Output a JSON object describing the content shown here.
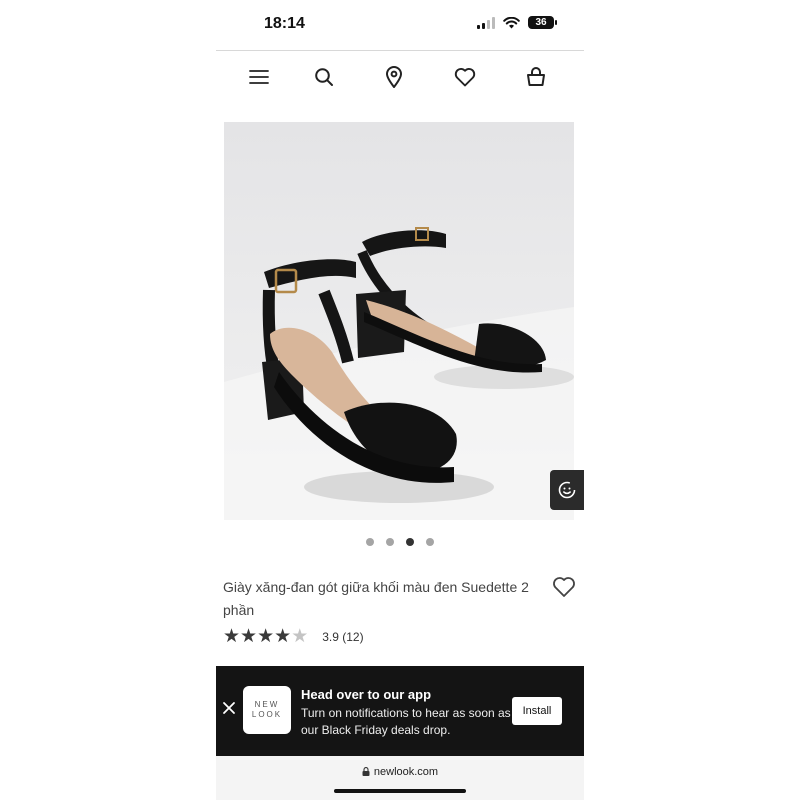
{
  "status_bar": {
    "time": "18:14",
    "battery": "36"
  },
  "nav": {
    "icons": [
      "menu-icon",
      "search-icon",
      "location-pin-icon",
      "heart-icon",
      "bag-icon"
    ]
  },
  "carousel": {
    "count": 4,
    "active": 3
  },
  "product": {
    "title": "Giày xăng-đan gót giữa khối màu đen Suedette 2 phần",
    "rating": 3.9,
    "rating_text": "3.9 (12)"
  },
  "app_banner": {
    "logo_line1": "NEW",
    "logo_line2": "LOOK",
    "title": "Head over to our app",
    "body": "Turn on notifications to hear as soon as our Black Friday deals drop.",
    "install_label": "Install"
  },
  "browser": {
    "url": "newlook.com"
  },
  "colors": {
    "banner_bg": "#141414",
    "star_filled": "#3a3a3a",
    "star_empty": "#c4c4c4"
  }
}
